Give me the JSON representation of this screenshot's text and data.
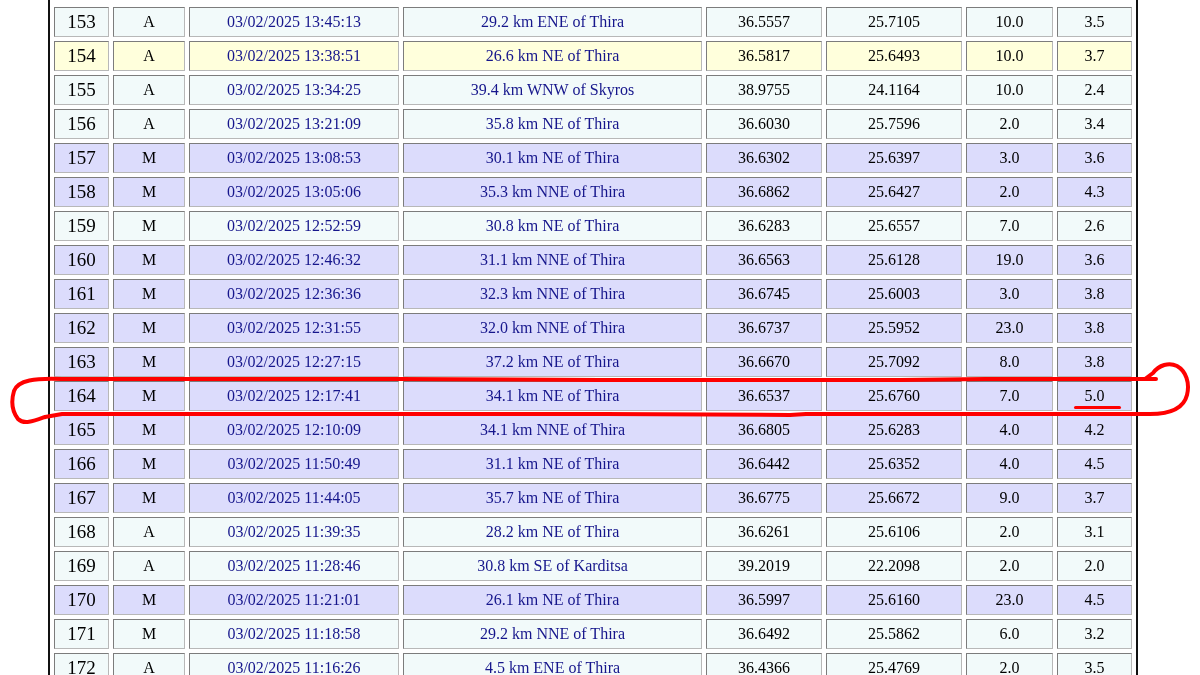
{
  "table": {
    "rows": [
      {
        "cells": [
          "153",
          "A",
          "03/02/2025 13:45:13",
          "29.2 km ENE of Thira",
          "36.5557",
          "25.7105",
          "10.0",
          "3.5"
        ],
        "color": "#f2fafa",
        "circled": false,
        "underlined": false
      },
      {
        "cells": [
          "154",
          "A",
          "03/02/2025 13:38:51",
          "26.6 km NE of Thira",
          "36.5817",
          "25.6493",
          "10.0",
          "3.7"
        ],
        "color": "#ffffdc",
        "circled": false,
        "underlined": false
      },
      {
        "cells": [
          "155",
          "A",
          "03/02/2025 13:34:25",
          "39.4 km WNW of Skyros",
          "38.9755",
          "24.1164",
          "10.0",
          "2.4"
        ],
        "color": "#f2fafa",
        "circled": false,
        "underlined": false
      },
      {
        "cells": [
          "156",
          "A",
          "03/02/2025 13:21:09",
          "35.8 km NE of Thira",
          "36.6030",
          "25.7596",
          "2.0",
          "3.4"
        ],
        "color": "#f2fafa",
        "circled": false,
        "underlined": false
      },
      {
        "cells": [
          "157",
          "M",
          "03/02/2025 13:08:53",
          "30.1 km NE of Thira",
          "36.6302",
          "25.6397",
          "3.0",
          "3.6"
        ],
        "color": "#dcdcfc",
        "circled": false,
        "underlined": false
      },
      {
        "cells": [
          "158",
          "M",
          "03/02/2025 13:05:06",
          "35.3 km NNE of Thira",
          "36.6862",
          "25.6427",
          "2.0",
          "4.3"
        ],
        "color": "#dcdcfc",
        "circled": false,
        "underlined": false
      },
      {
        "cells": [
          "159",
          "M",
          "03/02/2025 12:52:59",
          "30.8 km NE of Thira",
          "36.6283",
          "25.6557",
          "7.0",
          "2.6"
        ],
        "color": "#f2fafa",
        "circled": false,
        "underlined": false
      },
      {
        "cells": [
          "160",
          "M",
          "03/02/2025 12:46:32",
          "31.1 km NNE of Thira",
          "36.6563",
          "25.6128",
          "19.0",
          "3.6"
        ],
        "color": "#dcdcfc",
        "circled": false,
        "underlined": false
      },
      {
        "cells": [
          "161",
          "M",
          "03/02/2025 12:36:36",
          "32.3 km NNE of Thira",
          "36.6745",
          "25.6003",
          "3.0",
          "3.8"
        ],
        "color": "#dcdcfc",
        "circled": false,
        "underlined": false
      },
      {
        "cells": [
          "162",
          "M",
          "03/02/2025 12:31:55",
          "32.0 km NNE of Thira",
          "36.6737",
          "25.5952",
          "23.0",
          "3.8"
        ],
        "color": "#dcdcfc",
        "circled": false,
        "underlined": false
      },
      {
        "cells": [
          "163",
          "M",
          "03/02/2025 12:27:15",
          "37.2 km NE of Thira",
          "36.6670",
          "25.7092",
          "8.0",
          "3.8"
        ],
        "color": "#dcdcfc",
        "circled": false,
        "underlined": false
      },
      {
        "cells": [
          "164",
          "M",
          "03/02/2025 12:17:41",
          "34.1 km NE of Thira",
          "36.6537",
          "25.6760",
          "7.0",
          "5.0"
        ],
        "color": "#dcdcfc",
        "circled": true,
        "underlined": true
      },
      {
        "cells": [
          "165",
          "M",
          "03/02/2025 12:10:09",
          "34.1 km NNE of Thira",
          "36.6805",
          "25.6283",
          "4.0",
          "4.2"
        ],
        "color": "#dcdcfc",
        "circled": false,
        "underlined": false
      },
      {
        "cells": [
          "166",
          "M",
          "03/02/2025 11:50:49",
          "31.1 km NE of Thira",
          "36.6442",
          "25.6352",
          "4.0",
          "4.5"
        ],
        "color": "#dcdcfc",
        "circled": false,
        "underlined": false
      },
      {
        "cells": [
          "167",
          "M",
          "03/02/2025 11:44:05",
          "35.7 km NE of Thira",
          "36.6775",
          "25.6672",
          "9.0",
          "3.7"
        ],
        "color": "#dcdcfc",
        "circled": false,
        "underlined": false
      },
      {
        "cells": [
          "168",
          "A",
          "03/02/2025 11:39:35",
          "28.2 km NE of Thira",
          "36.6261",
          "25.6106",
          "2.0",
          "3.1"
        ],
        "color": "#f2fafa",
        "circled": false,
        "underlined": false
      },
      {
        "cells": [
          "169",
          "A",
          "03/02/2025 11:28:46",
          "30.8 km SE of Karditsa",
          "39.2019",
          "22.2098",
          "2.0",
          "2.0"
        ],
        "color": "#f2fafa",
        "circled": false,
        "underlined": false
      },
      {
        "cells": [
          "170",
          "M",
          "03/02/2025 11:21:01",
          "26.1 km NE of Thira",
          "36.5997",
          "25.6160",
          "23.0",
          "4.5"
        ],
        "color": "#dcdcfc",
        "circled": false,
        "underlined": false
      },
      {
        "cells": [
          "171",
          "M",
          "03/02/2025 11:18:58",
          "29.2 km NNE of Thira",
          "36.6492",
          "25.5862",
          "6.0",
          "3.2"
        ],
        "color": "#f2fafa",
        "circled": false,
        "underlined": false
      },
      {
        "cells": [
          "172",
          "A",
          "03/02/2025 11:16:26",
          "4.5 km ENE of Thira",
          "36.4366",
          "25.4769",
          "2.0",
          "3.5"
        ],
        "color": "#f2fafa",
        "circled": false,
        "underlined": false
      }
    ]
  }
}
